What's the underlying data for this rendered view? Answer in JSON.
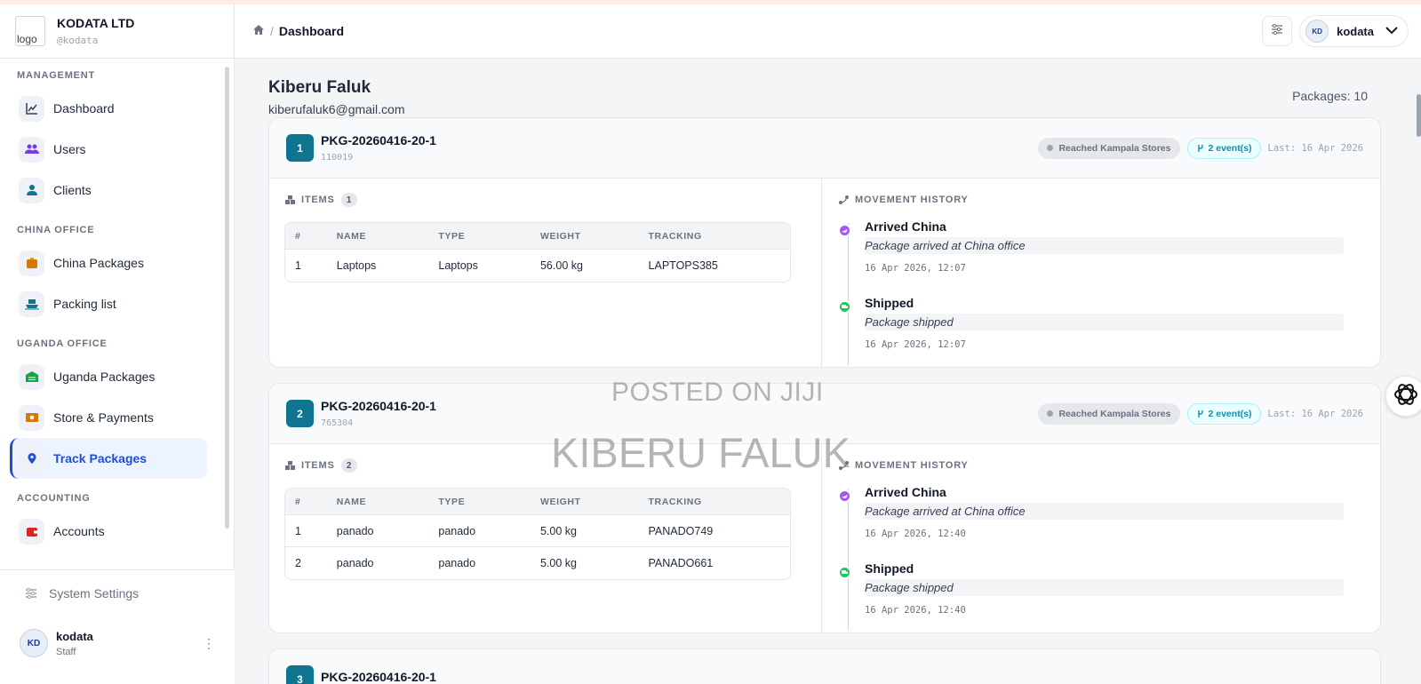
{
  "brand": {
    "logo_alt": "logo",
    "name": "KODATA LTD",
    "handle": "@kodata"
  },
  "sidebar": {
    "sections": [
      {
        "title": "MANAGEMENT",
        "items": [
          {
            "label": "Dashboard",
            "icon": "chart-icon",
            "color": "#374151"
          },
          {
            "label": "Users",
            "icon": "users-icon",
            "color": "#7c3aed"
          },
          {
            "label": "Clients",
            "icon": "client-icon",
            "color": "#0e7490"
          }
        ]
      },
      {
        "title": "CHINA OFFICE",
        "items": [
          {
            "label": "China Packages",
            "icon": "box-icon",
            "color": "#d97706"
          },
          {
            "label": "Packing list",
            "icon": "ship-icon",
            "color": "#0e7490"
          }
        ]
      },
      {
        "title": "UGANDA OFFICE",
        "items": [
          {
            "label": "Uganda Packages",
            "icon": "warehouse-icon",
            "color": "#16a34a"
          },
          {
            "label": "Store & Payments",
            "icon": "cash-icon",
            "color": "#d97706"
          },
          {
            "label": "Track Packages",
            "icon": "location-pin-icon",
            "color": "#1d4ed8",
            "active": true
          }
        ]
      },
      {
        "title": "ACCOUNTING",
        "items": [
          {
            "label": "Accounts",
            "icon": "wallet-icon",
            "color": "#dc2626"
          }
        ]
      }
    ],
    "settings_label": "System Settings",
    "user": {
      "name": "kodata",
      "role": "Staff",
      "avatar_text": "KD"
    }
  },
  "header": {
    "breadcrumb": "Dashboard",
    "user_name": "kodata",
    "avatar_text": "KD"
  },
  "client": {
    "name": "Kiberu Faluk",
    "email": "kiberufaluk6@gmail.com",
    "packages_label": "Packages: 10"
  },
  "packages": [
    {
      "index": "1",
      "code": "PKG-20260416-20-1",
      "id": "110019",
      "status": "Reached Kampala Stores",
      "events_label": "2 event(s)",
      "last": "Last: 16 Apr 2026",
      "items_title": "ITEMS",
      "items_count": "1",
      "columns": [
        "#",
        "NAME",
        "TYPE",
        "WEIGHT",
        "TRACKING"
      ],
      "rows": [
        [
          "1",
          "Laptops",
          "Laptops",
          "56.00 kg",
          "LAPTOPS385"
        ]
      ],
      "history_title": "MOVEMENT HISTORY",
      "events": [
        {
          "title": "Arrived China",
          "desc": "Package arrived at China office",
          "time": "16 Apr 2026, 12:07",
          "color": "#a855f7"
        },
        {
          "title": "Shipped",
          "desc": "Package shipped",
          "time": "16 Apr 2026, 12:07",
          "color": "#22c55e"
        }
      ]
    },
    {
      "index": "2",
      "code": "PKG-20260416-20-1",
      "id": "765304",
      "status": "Reached Kampala Stores",
      "events_label": "2 event(s)",
      "last": "Last: 16 Apr 2026",
      "items_title": "ITEMS",
      "items_count": "2",
      "columns": [
        "#",
        "NAME",
        "TYPE",
        "WEIGHT",
        "TRACKING"
      ],
      "rows": [
        [
          "1",
          "panado",
          "panado",
          "5.00 kg",
          "PANADO749"
        ],
        [
          "2",
          "panado",
          "panado",
          "5.00 kg",
          "PANADO661"
        ]
      ],
      "history_title": "MOVEMENT HISTORY",
      "events": [
        {
          "title": "Arrived China",
          "desc": "Package arrived at China office",
          "time": "16 Apr 2026, 12:40",
          "color": "#a855f7"
        },
        {
          "title": "Shipped",
          "desc": "Package shipped",
          "time": "16 Apr 2026, 12:40",
          "color": "#22c55e"
        }
      ]
    },
    {
      "index": "3",
      "code": "PKG-20260416-20-1"
    }
  ],
  "watermark": {
    "line1": "POSTED ON JIJI",
    "line2": "KIBERU FALUK"
  }
}
